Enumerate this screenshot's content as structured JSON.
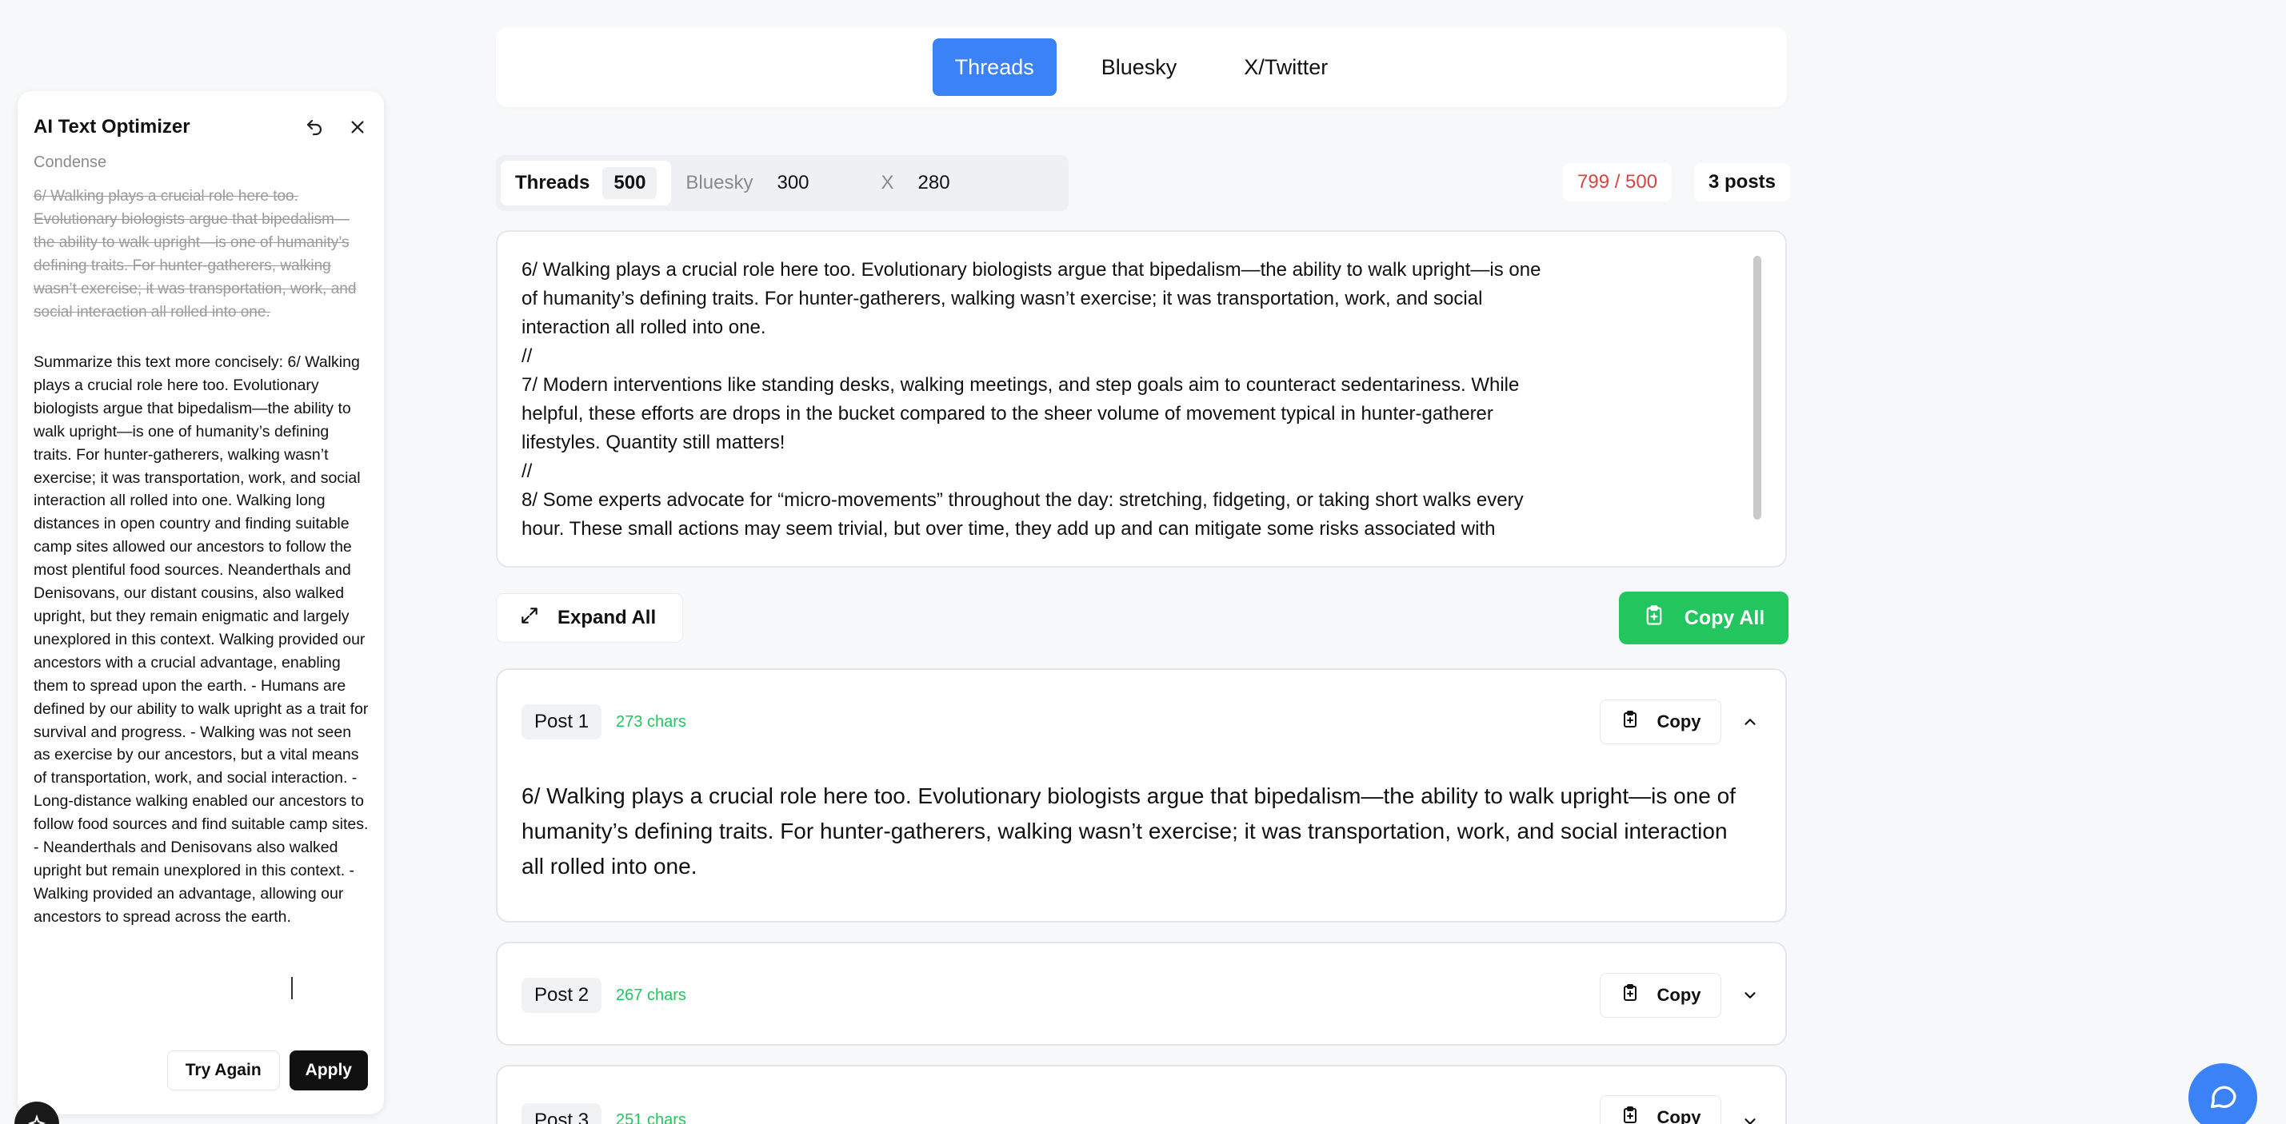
{
  "optimizer": {
    "title": "AI Text Optimizer",
    "mode": "Condense",
    "original": "6/ Walking plays a crucial role here too. Evolutionary biologists argue that bipedalism—the ability to walk upright—is one of humanity’s defining traits. For hunter-gatherers, walking wasn’t exercise; it was transportation, work, and social interaction all rolled into one.",
    "result": "Summarize this text more concisely: 6/ Walking plays a crucial role here too. Evolutionary biologists argue that bipedalism—the ability to walk upright—is one of humanity’s defining traits. For hunter-gatherers, walking wasn’t exercise; it was transportation, work, and social interaction all rolled into one. Walking long distances in open country and finding suitable camp sites allowed our ancestors to follow the most plentiful food sources. Neanderthals and Denisovans, our distant cousins, also walked upright, but they remain enigmatic and largely unexplored in this context. Walking provided our ancestors with a crucial advantage, enabling them to spread upon the earth. - Humans are defined by our ability to walk upright as a trait for survival and progress. - Walking was not seen as exercise by our ancestors, but a vital means of transportation, work, and social interaction. - Long-distance walking enabled our ancestors to follow food sources and find suitable camp sites. - Neanderthals and Denisovans also walked upright but remain unexplored in this context. - Walking provided an advantage, allowing our ancestors to spread across the earth.",
    "try_again_label": "Try Again",
    "apply_label": "Apply"
  },
  "platform_tabs": [
    {
      "label": "Threads",
      "active": true
    },
    {
      "label": "Bluesky",
      "active": false
    },
    {
      "label": "X/Twitter",
      "active": false
    }
  ],
  "limits": [
    {
      "label": "Threads",
      "value": "500",
      "active": true
    },
    {
      "label": "Bluesky",
      "value": "300",
      "active": false
    },
    {
      "label": "X",
      "value": "280",
      "active": false
    }
  ],
  "char_counter": "799 / 500",
  "posts_count": "3 posts",
  "editor_text": "6/ Walking plays a crucial role here too. Evolutionary biologists argue that bipedalism—the ability to walk upright—is one\nof humanity’s defining traits. For hunter-gatherers, walking wasn’t exercise; it was transportation, work, and social\ninteraction all rolled into one.\n//\n7/ Modern interventions like standing desks, walking meetings, and step goals aim to counteract sedentariness. While\nhelpful, these efforts are drops in the bucket compared to the sheer volume of movement typical in hunter-gatherer\nlifestyles. Quantity still matters!\n//\n8/ Some experts advocate for “micro-movements” throughout the day: stretching, fidgeting, or taking short walks every\nhour. These small actions may seem trivial, but over time, they add up and can mitigate some risks associated with",
  "expand_all_label": "Expand All",
  "copy_all_label": "Copy All",
  "copy_label": "Copy",
  "posts": [
    {
      "label": "Post 1",
      "chars": "273 chars",
      "expanded": true,
      "body": "6/ Walking plays a crucial role here too. Evolutionary biologists argue that bipedalism—the ability to walk upright—is one of humanity’s defining traits. For hunter-gatherers, walking wasn’t exercise; it was transportation, work, and social interaction all rolled into one."
    },
    {
      "label": "Post 2",
      "chars": "267 chars",
      "expanded": false
    },
    {
      "label": "Post 3",
      "chars": "251 chars",
      "expanded": false
    }
  ],
  "colors": {
    "accent_blue": "#3b82f6",
    "success_green": "#22c55e",
    "over_limit_red": "#d64545"
  },
  "icons": [
    "undo-icon",
    "close-icon",
    "expand-icon",
    "clipboard-icon",
    "chevron-up-icon",
    "chevron-down-icon",
    "chat-icon",
    "sparkle-icon"
  ]
}
